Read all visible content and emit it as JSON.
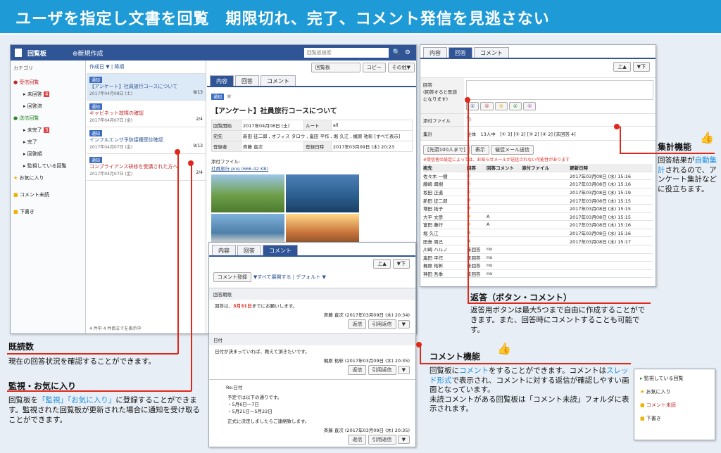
{
  "banner": {
    "title": "ユーザを指定し文書を回覧　期限切れ、完了、コメント発信を見逃さない"
  },
  "left": {
    "app_title": "回覧板",
    "new_label": "新規作成",
    "search_placeholder": "回覧板検索",
    "category_label": "カテゴリ",
    "tree": [
      "受信回覧",
      "未回答",
      "回答済",
      "送信回覧",
      "未完了",
      "完了",
      "回答順",
      "監視している回覧",
      "お気に入り",
      "コメント未読",
      "下書き"
    ],
    "list_header": "作成日 ▼ | 降順",
    "list_footer": "4 件中 4 件目までを表示中",
    "items": [
      {
        "tag": "通知",
        "title": "【アンケート】社員旅行コースについて",
        "date": "2017年04月08日 (土)",
        "count": "8/13"
      },
      {
        "tag": "通知",
        "title": "キャビネット故障の確認",
        "date": "2017年04月07日 (金)",
        "count": "2/4"
      },
      {
        "tag": "通知",
        "title": "インフルエンザ予防接種受診確認",
        "date": "2017年04月07日 (金)",
        "count": "9/13"
      },
      {
        "tag": "通知",
        "title": "コンプライアンス研修を受講された方へ",
        "date": "2017年04月07日 (金)",
        "count": "2/4"
      }
    ],
    "toolbar_select": "回覧板",
    "copy_btn": "コピー",
    "other_btn": "その他▼",
    "tabs": [
      "内容",
      "回答",
      "コメント"
    ],
    "doc_tag": "通知",
    "doc_title": "【アンケート】社員旅行コースについて",
    "meta": [
      [
        "回覧開始",
        "2017年04月08日 (土)",
        "ルート",
        "all"
      ],
      [
        "宛先",
        "新田 征二郎 , オフィス タロウ , 嵐田 平作 , 堀 久江 , 梶原 祐彰 [すべて表示]",
        "",
        ""
      ],
      [
        "登録者",
        "斉藤 直次",
        "登録日時",
        "2017年03月09日 (木) 20:23"
      ]
    ],
    "attach_label": "添付ファイル:",
    "attach_file": "社員旅行.png (666.42 KB)"
  },
  "comment": {
    "tabs": [
      "内容",
      "回答",
      "コメント"
    ],
    "register_btn": "コメント登録",
    "expand": "▼すべて展開する | デフォルト ▼",
    "threads": [
      {
        "title": "回答期限",
        "body_pre": "回答は、",
        "body_red": "3月31日",
        "body_post": "までにお願いします。",
        "author": "斉藤 直次 (2017年03月09日 (木) 20:34)"
      },
      {
        "title": "日付",
        "body": "日付が決まっていれば、教えて頂きたいです。",
        "author": "梶原 祐彰 (2017年03月09日 (木) 20:35)"
      },
      {
        "title": "Re:日付",
        "body": "予定では以下の通りです。",
        "lines": [
          "・5月6日〜7日",
          "・5月21日〜5月22日"
        ],
        "note": "正式に決定しましたらご連絡致します。",
        "author": "斉藤 直次 (2017年03月09日 (木) 20:35)"
      }
    ],
    "reply": "返信",
    "quote": "引用返信"
  },
  "answer": {
    "tabs": [
      "内容",
      "回答",
      "コメント"
    ],
    "answer_label": "回答\n(回答すると既読になります)",
    "buttons": [
      "①",
      "②",
      "③",
      "④",
      "⑤"
    ],
    "attach": "添付ファイル",
    "agg_label": "集計",
    "agg": "全体　13人中　[① 3] [② 2] [③ 2] [④ 2] [未回答 4]",
    "filter": "[先頭100人まで]",
    "show": "表示",
    "remind": "催促メール送信",
    "warn": "※受信者の設定によっては、お知らせメールが送信されない可能性があります",
    "cols": [
      "宛先",
      "回答",
      "回答コメント",
      "添付ファイル",
      "更新日時"
    ],
    "rows": [
      [
        "佐々木 一樹",
        "①",
        "",
        "",
        "2017年03月08日 (水) 15:16"
      ],
      [
        "藤崎 興樹",
        "①",
        "",
        "",
        "2017年03月08日 (水) 15:16"
      ],
      [
        "坂田 正道",
        "①",
        "",
        "",
        "2017年03月08日 (水) 15:19"
      ],
      [
        "新田 征二郎",
        "②",
        "",
        "",
        "2017年03月08日 (水) 15:15"
      ],
      [
        "増田 拓子",
        "②",
        "",
        "",
        "2017年03月08日 (水) 15:15"
      ],
      [
        "大平 文彦",
        "③",
        "A",
        "",
        "2017年03月08日 (水) 15:15"
      ],
      [
        "富田 藤行",
        "③",
        "A",
        "",
        "2017年03月08日 (水) 15:16"
      ],
      [
        "堀 久江",
        "④",
        "",
        "",
        "2017年03月08日 (水) 15:16"
      ],
      [
        "田島 周己",
        "④",
        "",
        "",
        "2017年03月08日 (水) 15:17"
      ],
      [
        "川崎 ハルノ",
        "未回答",
        "no",
        "",
        ""
      ],
      [
        "嵐田 平作",
        "未回答",
        "no",
        "",
        ""
      ],
      [
        "梶原 祐彰",
        "未回答",
        "no",
        "",
        ""
      ],
      [
        "神田 吾季",
        "未回答",
        "no",
        "",
        ""
      ]
    ]
  },
  "mini": {
    "items": [
      "監視している回覧",
      "お気に入り",
      "コメント未読",
      "下書き"
    ]
  },
  "callouts": {
    "kidoku_head": "既読数",
    "kidoku_text": "現在の回答状況を確認することができます。",
    "watch_head": "監視・お気に入り",
    "watch_pre": "回覧板を",
    "watch_blue": "「監視」「お気に入り」",
    "watch_post": "に登録することができます。監視された回覧板が更新された場合に通知を受け取ることができます。",
    "agg_head": "集計機能",
    "agg_pre": "回答結果が",
    "agg_blue": "自動集計",
    "agg_post": "されるので、アンケート集計などに役立ちます。",
    "reply_head": "返答（ボタン・コメント）",
    "reply_text": "返答用ボタンは最大5つまで自由に作成することができます。また、回答時にコメントすることも可能です。",
    "cm_head": "コメント機能",
    "cm_pre": "回覧板に",
    "cm_blue1": "コメント",
    "cm_mid": "をすることができます。コメントは",
    "cm_blue2": "スレッド形式",
    "cm_post": "で表示され、コメントに対する返信が確認しやすい画面となっています。\n未読コメントがある回覧板は「コメント未読」フォルダに表示されます。"
  }
}
